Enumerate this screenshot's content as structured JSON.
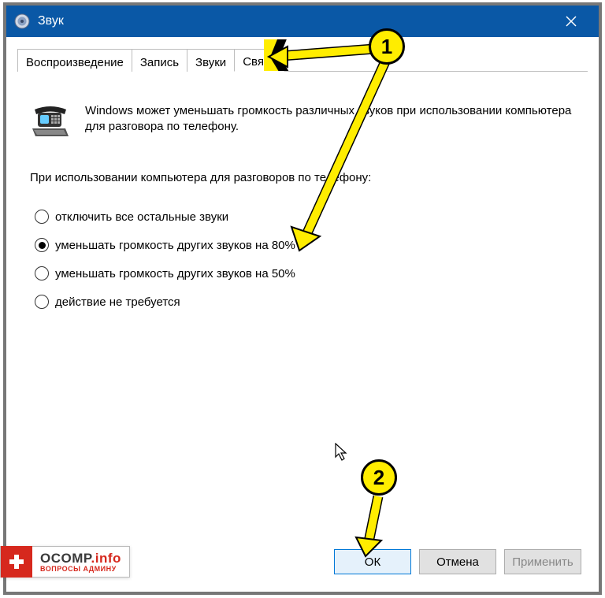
{
  "window": {
    "title": "Звук",
    "close_icon": "×"
  },
  "tabs": [
    {
      "label": "Воспроизведение",
      "selected": false
    },
    {
      "label": "Запись",
      "selected": false
    },
    {
      "label": "Звуки",
      "selected": false
    },
    {
      "label": "Связь",
      "selected": true
    }
  ],
  "intro_text": "Windows может уменьшать громкость различных звуков при использовании компьютера для разговора по телефону.",
  "section_title": "При использовании компьютера для разговоров по телефону:",
  "options": [
    {
      "label": "отключить все остальные звуки",
      "selected": false
    },
    {
      "label": "уменьшать громкость других звуков на 80%",
      "selected": true
    },
    {
      "label": "уменьшать громкость других звуков на 50%",
      "selected": false
    },
    {
      "label": "действие не требуется",
      "selected": false
    }
  ],
  "buttons": {
    "ok": "ОК",
    "cancel": "Отмена",
    "apply": "Применить"
  },
  "annotations": {
    "step1": "1",
    "step2": "2"
  },
  "badge": {
    "name": "OCOMP",
    "suffix": ".info",
    "subtitle": "ВОПРОСЫ АДМИНУ"
  },
  "icons": {
    "speaker": "speaker-icon",
    "phone": "phone-icon",
    "close": "close-icon"
  },
  "colors": {
    "titlebar": "#0a58a6",
    "annotation": "#ffed00",
    "badge_red": "#d6281d",
    "focus_blue": "#0078d7"
  }
}
